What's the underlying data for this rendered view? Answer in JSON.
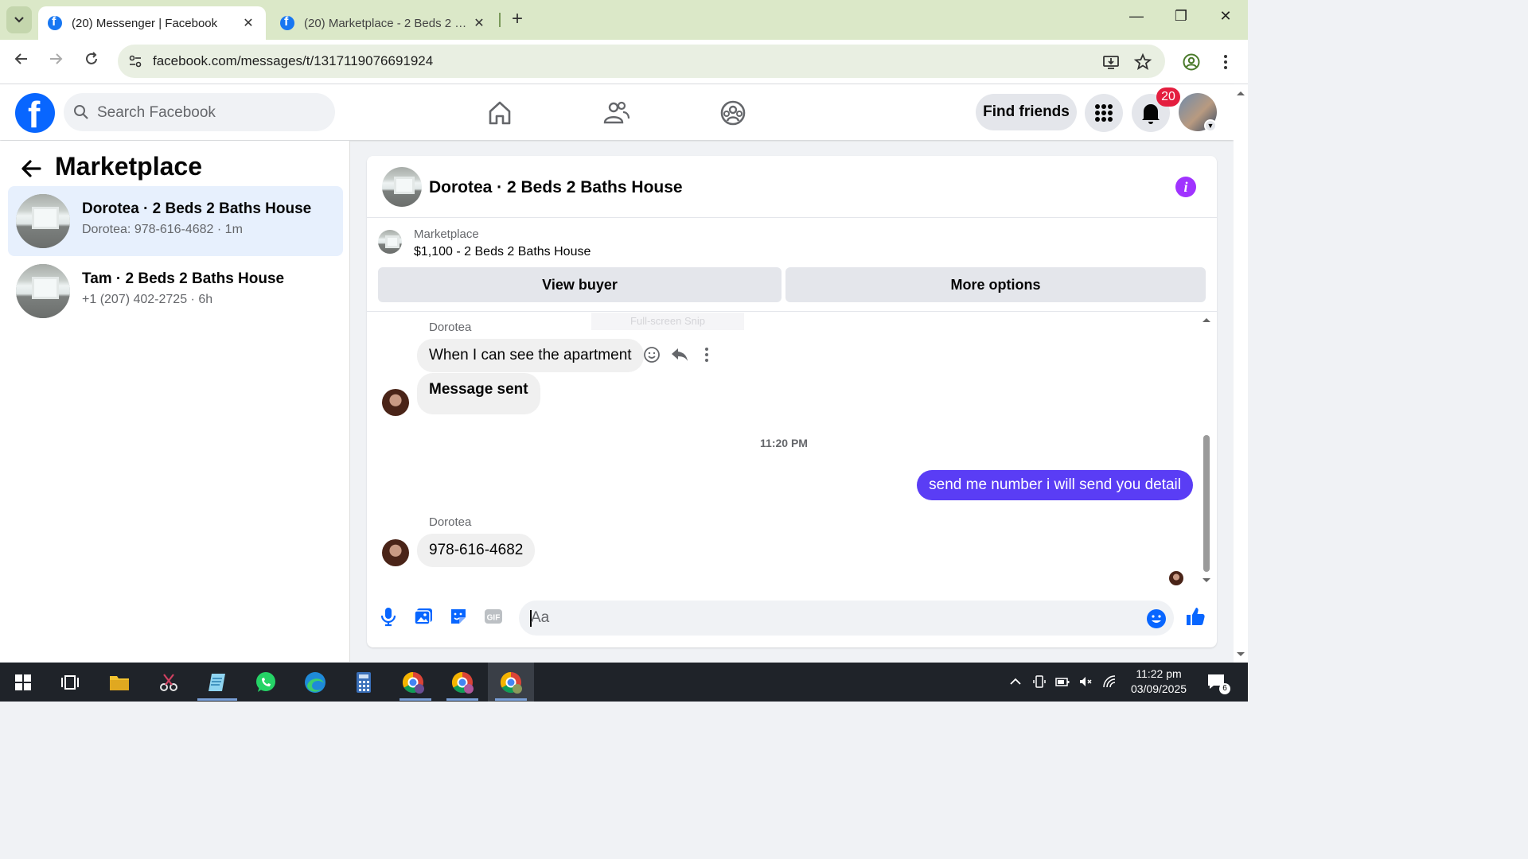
{
  "browser": {
    "tabs": [
      {
        "title": "(20) Messenger | Facebook",
        "active": true
      },
      {
        "title": "(20) Marketplace - 2 Beds 2 Baths House",
        "active": false
      }
    ],
    "new_tab": "+",
    "url": "facebook.com/messages/t/1317119076691924",
    "window_controls": {
      "minimize": "—",
      "restore": "❐",
      "close": "✕"
    }
  },
  "facebook": {
    "search_placeholder": "Search Facebook",
    "find_friends_label": "Find friends",
    "notification_count": "20"
  },
  "sidebar": {
    "title": "Marketplace",
    "conversations": [
      {
        "name": "Dorotea · 2 Beds 2 Baths House",
        "preview": "Dorotea: 978-616-4682 · 1m",
        "active": true
      },
      {
        "name": "Tam · 2 Beds 2 Baths House",
        "preview": "+1 (207) 402-2725 · 6h",
        "active": false
      }
    ]
  },
  "chat": {
    "title": "Dorotea · 2 Beds 2 Baths House",
    "marketplace_label": "Marketplace",
    "listing": "$1,100 - 2 Beds 2 Baths House",
    "view_buyer_label": "View buyer",
    "more_options_label": "More options",
    "ghost_overlay": "Full-screen Snip",
    "messages": [
      {
        "sender": "Dorotea",
        "text": "When I can see the apartment",
        "direction": "in"
      },
      {
        "text": "Message sent",
        "direction": "in"
      },
      {
        "timestamp": "11:20 PM"
      },
      {
        "text": "send me number i will send you detail",
        "direction": "out"
      },
      {
        "sender": "Dorotea",
        "text": "978-616-4682",
        "direction": "in"
      }
    ],
    "composer_placeholder": "Aa"
  },
  "taskbar": {
    "time": "11:22 pm",
    "date": "03/09/2025",
    "notification_count": "6"
  },
  "colors": {
    "fb_blue": "#0866ff",
    "outgoing_bubble": "#5a3df5",
    "info_purple": "#a033ff",
    "composer_icons": "#0866ff",
    "badge_red": "#e41e3f"
  }
}
